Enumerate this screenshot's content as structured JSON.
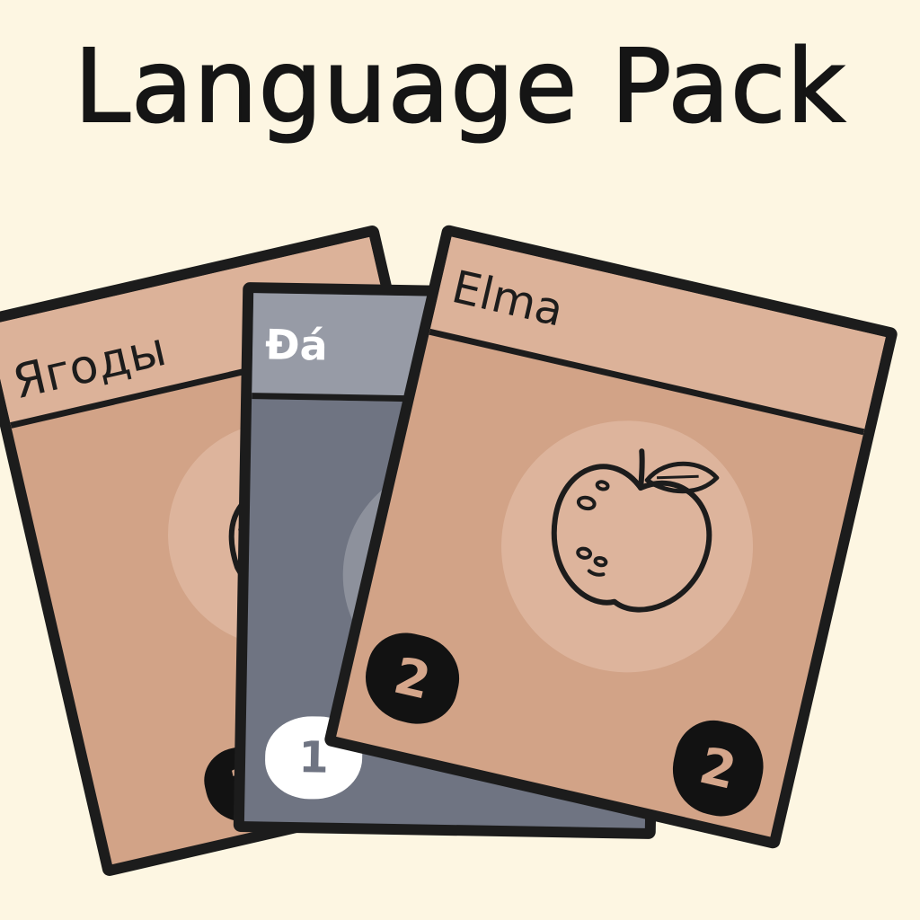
{
  "title": "Language Pack",
  "cards": [
    {
      "word": "Ягоды",
      "icon": "berries-icon",
      "badge": "1",
      "color": "#d2a387"
    },
    {
      "word": "Đá",
      "icon": "rock-icon",
      "badge": "1",
      "color": "#6f7482"
    },
    {
      "word": "Elma",
      "icon": "apple-icon",
      "badge_top": "2",
      "badge_bottom": "2",
      "color": "#d2a387"
    }
  ],
  "background": "#fdf6e2"
}
